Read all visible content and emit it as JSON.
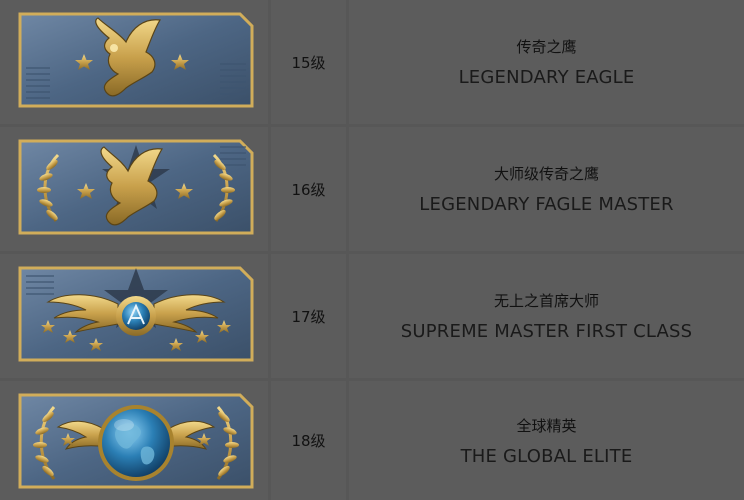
{
  "colors": {
    "background": "#575757",
    "cell": "#5c5c5c",
    "badge_plate": "#5d7694",
    "gold": "#d1ad5a",
    "globe": "#2b7fb5"
  },
  "ranks": [
    {
      "level": "15级",
      "name_cn": "传奇之鹰",
      "name_en": "LEGENDARY EAGLE",
      "badge_icon": "legendary-eagle-icon"
    },
    {
      "level": "16级",
      "name_cn": "大师级传奇之鹰",
      "name_en": "LEGENDARY FAGLE MASTER",
      "badge_icon": "legendary-eagle-master-icon"
    },
    {
      "level": "17级",
      "name_cn": "无上之首席大师",
      "name_en": "SUPREME MASTER FIRST CLASS",
      "badge_icon": "supreme-master-icon"
    },
    {
      "level": "18级",
      "name_cn": "全球精英",
      "name_en": "THE GLOBAL ELITE",
      "badge_icon": "global-elite-icon"
    }
  ]
}
